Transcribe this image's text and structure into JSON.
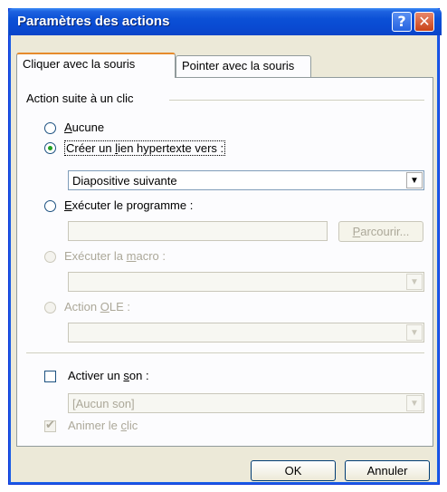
{
  "window": {
    "title": "Paramètres des actions",
    "help_glyph": "?",
    "close_glyph": "✕"
  },
  "tabs": [
    {
      "label": "Cliquer avec la souris",
      "active": true
    },
    {
      "label": "Pointer avec la souris",
      "active": false
    }
  ],
  "group": {
    "label": "Action suite à un clic"
  },
  "options": {
    "none": {
      "pre": "",
      "u": "A",
      "post": "ucune",
      "checked": false,
      "enabled": true
    },
    "hyperlink": {
      "pre": "Créer un ",
      "u": "l",
      "post": "ien hypertexte vers :",
      "checked": true,
      "enabled": true
    },
    "hyperlink_target": "Diapositive suivante",
    "run_program": {
      "pre": "",
      "u": "E",
      "post": "xécuter le programme :",
      "checked": false,
      "enabled": true
    },
    "program_path": "",
    "browse": {
      "pre": "",
      "u": "P",
      "post": "arcourir..."
    },
    "run_macro": {
      "pre": "Exécuter la ",
      "u": "m",
      "post": "acro :",
      "checked": false,
      "enabled": false
    },
    "macro_value": "",
    "ole": {
      "pre": "Action ",
      "u": "O",
      "post": "LE :",
      "checked": false,
      "enabled": false
    },
    "ole_value": ""
  },
  "sound": {
    "activate": {
      "pre": "Activer un ",
      "u": "s",
      "post": "on :",
      "checked": false
    },
    "value": "[Aucun son]",
    "animate": {
      "pre": "Animer le ",
      "u": "c",
      "post": "lic",
      "checked": true,
      "enabled": false
    }
  },
  "footer": {
    "ok": "OK",
    "cancel": "Annuler"
  },
  "colors": {
    "titlebar": "#0a4ad2",
    "dialog_bg": "#ece9d8",
    "radio_dot": "#21a121",
    "disabled_text": "#aca899"
  }
}
